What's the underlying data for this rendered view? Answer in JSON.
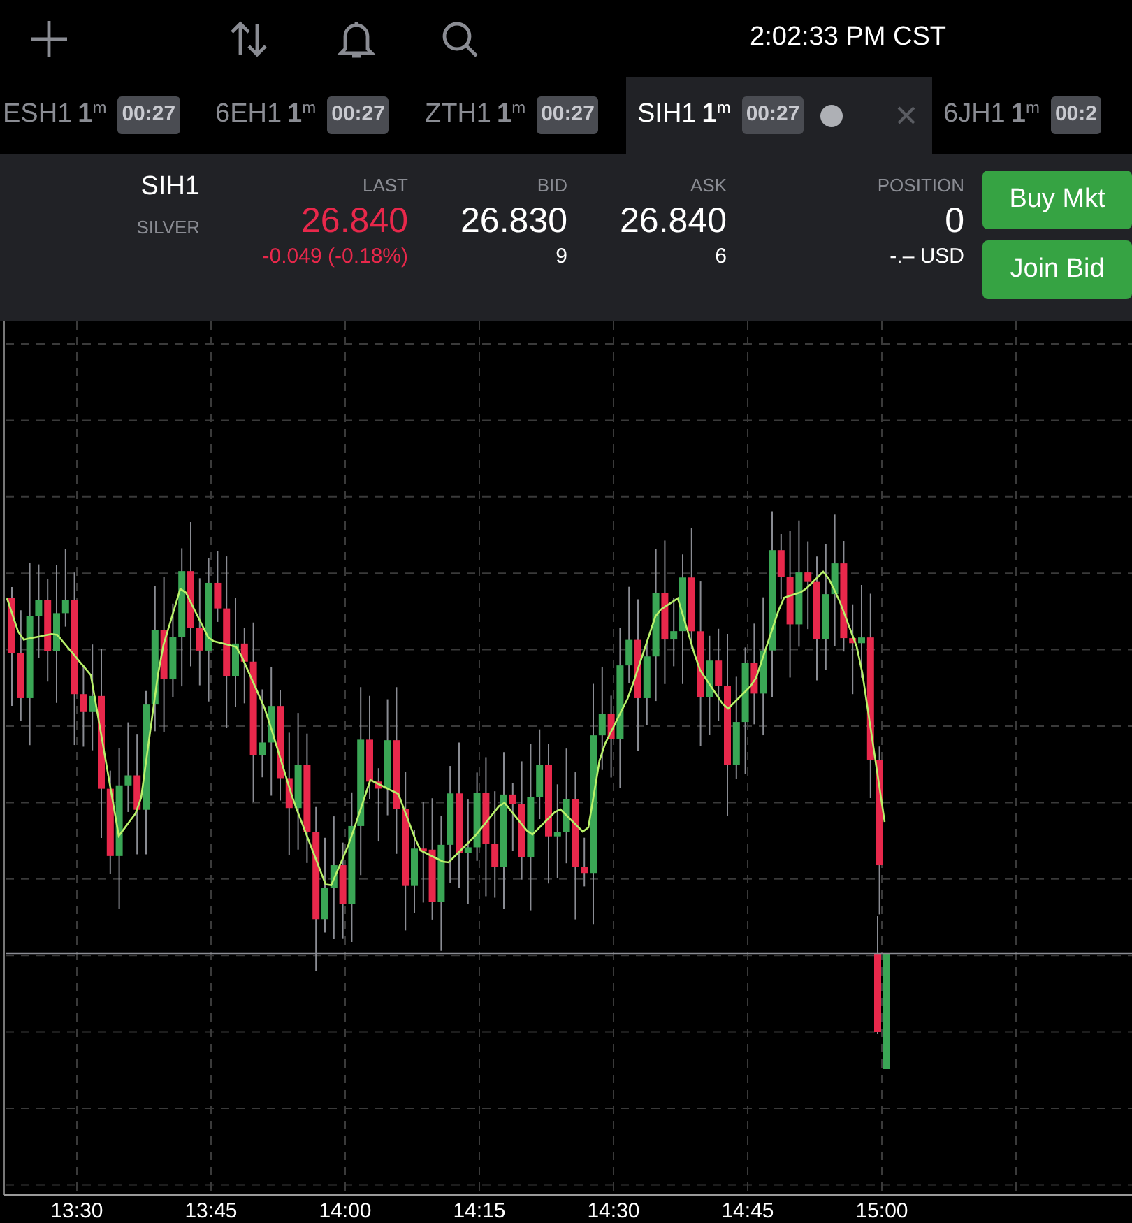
{
  "toolbar": {
    "clock": "2:02:33 PM CST"
  },
  "tabs": [
    {
      "symbol": "ESH1",
      "interval": "**1**$^{m}$",
      "timer": "00:27",
      "selected": false
    },
    {
      "symbol": "6EH1",
      "interval": "**1**$^{m}$",
      "timer": "00:27",
      "selected": false
    },
    {
      "symbol": "ZTH1",
      "interval": "**1**$^{m}$",
      "timer": "00:27",
      "selected": false
    },
    {
      "symbol": "SIH1",
      "interval": "**1**$^{m}$",
      "timer": "00:27",
      "selected": true
    },
    {
      "symbol": "6JH1",
      "interval": "**1**$^{m}$",
      "timer": "00:2",
      "selected": false
    }
  ],
  "quote": {
    "symbol": "SIH1",
    "name": "SILVER",
    "last": {
      "label": "LAST",
      "value": "26.840",
      "change": "-0.049 (-0.18%)",
      "falling": true
    },
    "bid": {
      "label": "BID",
      "value": "26.830",
      "size": "9"
    },
    "ask": {
      "label": "ASK",
      "value": "26.840",
      "size": "6"
    },
    "position": {
      "label": "POSITION",
      "value": "0",
      "pnl": "-.– USD"
    }
  },
  "buttons": [
    "Buy Mkt",
    "Join Bid"
  ],
  "chart": {
    "x_labels": [
      "13:30",
      "13:45",
      "14:00",
      "14:15",
      "14:30",
      "14:45",
      "15:00"
    ]
  }
}
